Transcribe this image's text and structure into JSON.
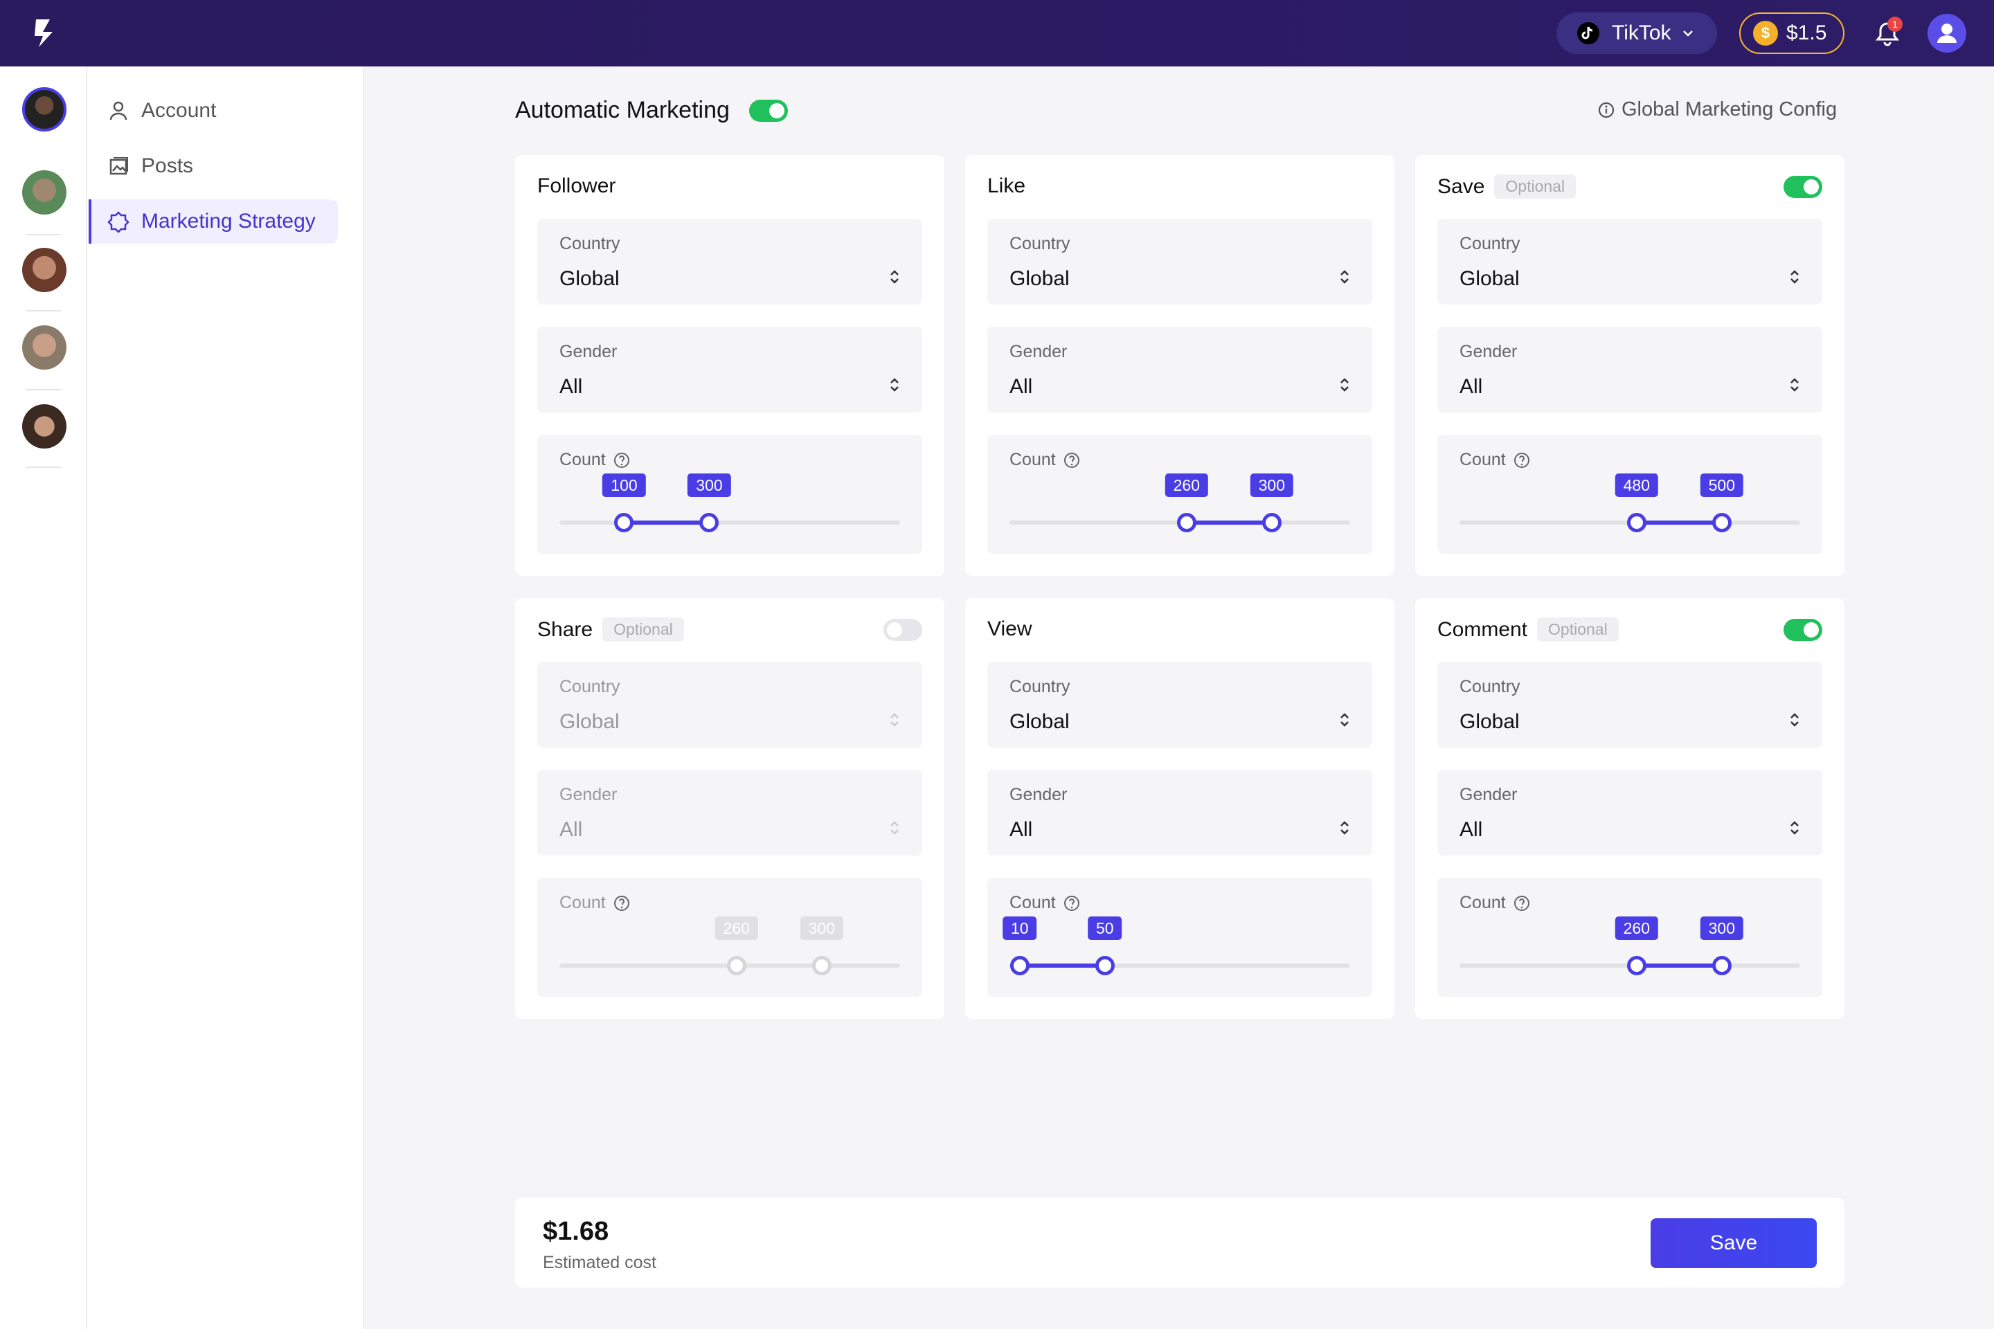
{
  "topbar": {
    "platform_label": "TikTok",
    "balance": "$1.5",
    "notification_count": "1"
  },
  "sidebar": {
    "items": [
      {
        "label": "Account",
        "icon": "user-icon"
      },
      {
        "label": "Posts",
        "icon": "gallery-icon"
      },
      {
        "label": "Marketing Strategy",
        "icon": "badge-icon",
        "active": true
      }
    ]
  },
  "main": {
    "title": "Automatic Marketing",
    "auto_enabled": true,
    "global_config_label": "Global Marketing Config"
  },
  "common": {
    "country_label": "Country",
    "gender_label": "Gender",
    "count_label": "Count",
    "optional_label": "Optional"
  },
  "cards": [
    {
      "title": "Follower",
      "optional": false,
      "enabled": true,
      "country": "Global",
      "gender": "All",
      "min": "100",
      "max": "300",
      "min_frac": 0.19,
      "max_frac": 0.44
    },
    {
      "title": "Like",
      "optional": false,
      "enabled": true,
      "country": "Global",
      "gender": "All",
      "min": "260",
      "max": "300",
      "min_frac": 0.52,
      "max_frac": 0.77
    },
    {
      "title": "Save",
      "optional": true,
      "enabled": true,
      "country": "Global",
      "gender": "All",
      "min": "480",
      "max": "500",
      "min_frac": 0.52,
      "max_frac": 0.77
    },
    {
      "title": "Share",
      "optional": true,
      "enabled": false,
      "country": "Global",
      "gender": "All",
      "min": "260",
      "max": "300",
      "min_frac": 0.52,
      "max_frac": 0.77
    },
    {
      "title": "View",
      "optional": false,
      "enabled": true,
      "country": "Global",
      "gender": "All",
      "min": "10",
      "max": "50",
      "min_frac": 0.03,
      "max_frac": 0.28
    },
    {
      "title": "Comment",
      "optional": true,
      "enabled": true,
      "country": "Global",
      "gender": "All",
      "min": "260",
      "max": "300",
      "min_frac": 0.52,
      "max_frac": 0.77
    }
  ],
  "footer": {
    "cost": "$1.68",
    "cost_label": "Estimated cost",
    "save_label": "Save"
  },
  "colors": {
    "accent": "#4a3de6",
    "toggle_on": "#20c05c",
    "topbar": "#2c1b63"
  }
}
